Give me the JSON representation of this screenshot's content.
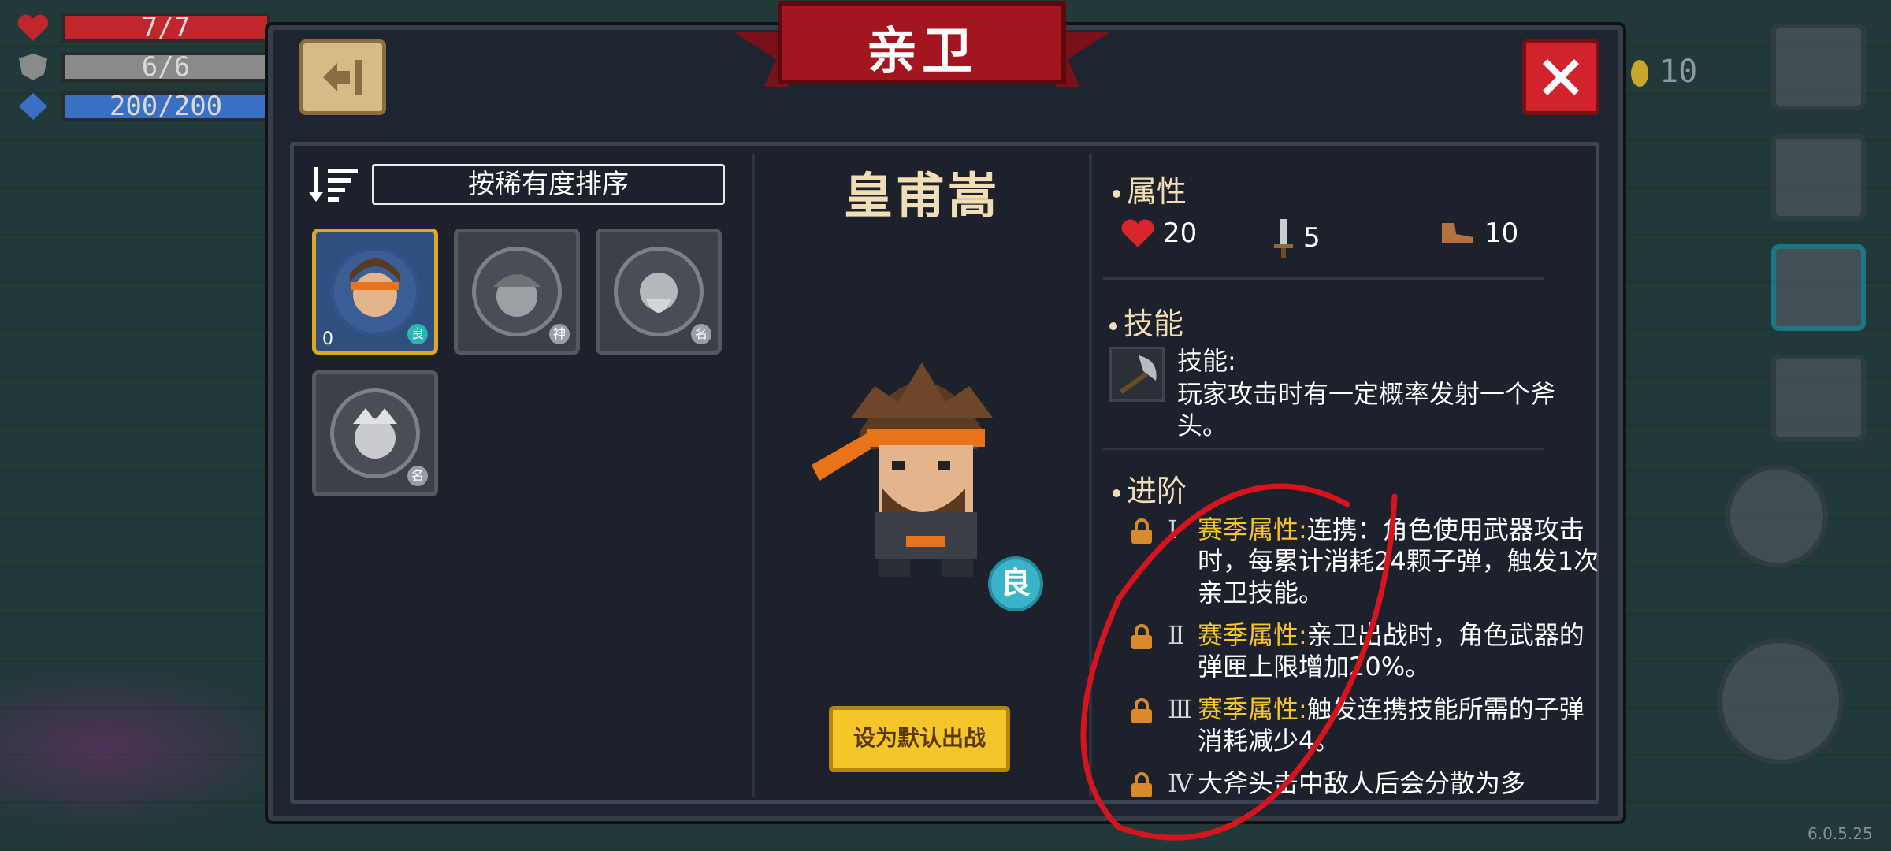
{
  "hud": {
    "hp": {
      "text": "7/7",
      "fill": 1.0,
      "color": "#c0272d"
    },
    "armor": {
      "text": "6/6",
      "fill": 1.0,
      "color": "#8a8a8a"
    },
    "energy": {
      "text": "200/200",
      "fill": 1.0,
      "color": "#3a6fc4"
    },
    "coins": "10"
  },
  "panel": {
    "title": "亲卫",
    "sort_label": "按稀有度排序"
  },
  "roster": [
    {
      "count": "0",
      "rarity": "良",
      "selected": true
    },
    {
      "rarity": "神",
      "selected": false
    },
    {
      "rarity": "名",
      "selected": false
    },
    {
      "rarity": "名",
      "selected": false
    }
  ],
  "hero": {
    "name": "皇甫嵩",
    "rarity": "良",
    "default_button": "设为默认出战"
  },
  "attributes": {
    "header": "属性",
    "hp": "20",
    "attack": "5",
    "speed": "10"
  },
  "skill": {
    "header": "技能",
    "label": "技能:",
    "desc": "玩家攻击时有一定概率发射一个斧头。"
  },
  "advance": {
    "header": "进阶",
    "items": [
      {
        "numeral": "Ⅰ",
        "tag": "赛季属性:",
        "text": "连携：角色使用武器攻击时，每累计消耗24颗子弹，触发1次亲卫技能。"
      },
      {
        "numeral": "Ⅱ",
        "tag": "赛季属性:",
        "text": "亲卫出战时，角色武器的弹匣上限增加20%。"
      },
      {
        "numeral": "Ⅲ",
        "tag": "赛季属性:",
        "text": "触发连携技能所需的子弹消耗减少4。"
      },
      {
        "numeral": "Ⅳ",
        "tag": "",
        "text": "大斧头击中敌人后会分散为多"
      }
    ]
  },
  "version": "6.0.5.25"
}
